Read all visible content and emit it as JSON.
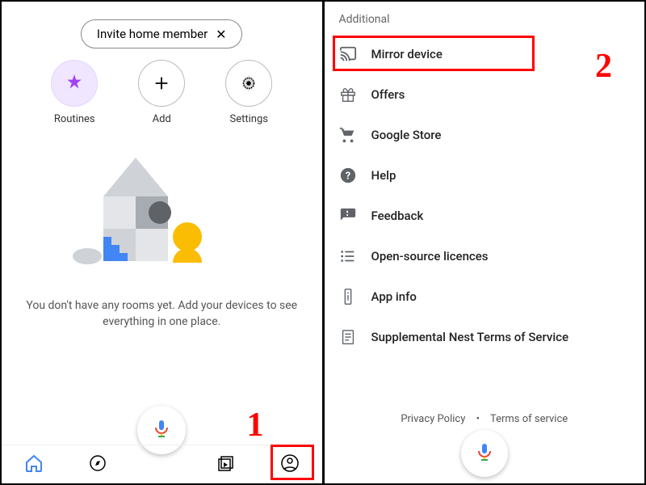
{
  "left": {
    "invite_label": "Invite home member",
    "actions": [
      {
        "label": "Routines"
      },
      {
        "label": "Add"
      },
      {
        "label": "Settings"
      }
    ],
    "empty_text": "You don't have any rooms yet. Add your devices to see everything in one place."
  },
  "right": {
    "section_title": "Additional",
    "items": [
      {
        "label": "Mirror device"
      },
      {
        "label": "Offers"
      },
      {
        "label": "Google Store"
      },
      {
        "label": "Help"
      },
      {
        "label": "Feedback"
      },
      {
        "label": "Open-source licences"
      },
      {
        "label": "App info"
      },
      {
        "label": "Supplemental Nest Terms of Service"
      }
    ],
    "footer": {
      "privacy": "Privacy Policy",
      "terms": "Terms of service"
    }
  },
  "annotations": {
    "num1": "1",
    "num2": "2"
  }
}
